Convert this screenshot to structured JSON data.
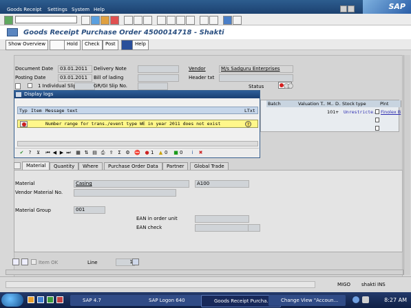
{
  "menu": {
    "items": [
      "Goods Receipt",
      "Settings",
      "System",
      "Help"
    ]
  },
  "brand": "SAP",
  "title": "Goods Receipt Purchase Order 4500014718 - Shakti",
  "app_toolbar": {
    "show_overview": "Show Overview",
    "hold": "Hold",
    "check": "Check",
    "post": "Post",
    "help": "Help"
  },
  "header": {
    "document_date_label": "Document Date",
    "document_date": "03.01.2011",
    "posting_date_label": "Posting Date",
    "posting_date": "03.01.2011",
    "delivery_note_label": "Delivery Note",
    "bill_of_lading_label": "Bill of lading",
    "vendor_label": "Vendor",
    "vendor": "M/s Sadguru Enterprises",
    "header_txt_label": "Header txt",
    "slip_label": "1 Individual Slip",
    "grgi_label": "GR/GI Slip No.",
    "status_label": "Status"
  },
  "dialog": {
    "title": "Display logs",
    "columns": [
      "Typ",
      "Item",
      "Message text",
      "LTxt"
    ],
    "message": "Number range for trans./event type WE in year 2011 does not exist",
    "counts": {
      "error": "1",
      "warning": "0",
      "success": "0"
    }
  },
  "grid": {
    "columns": [
      "Batch",
      "Valuation T..",
      "M..",
      "D..",
      "Stock type",
      "Plnt"
    ],
    "row": {
      "item": "101",
      "sign": "+",
      "stock_type": "Unrestricte..",
      "plant": "Finolex B"
    }
  },
  "tabs": [
    "Material",
    "Quantity",
    "Where",
    "Purchase Order Data",
    "Partner",
    "Global Trade"
  ],
  "detail": {
    "material_label": "Material",
    "material": "Casing",
    "material_code": "A100",
    "vendor_material_label": "Vendor Material No.",
    "material_group_label": "Material Group",
    "material_group": "001",
    "ean_order_unit_label": "EAN in order unit",
    "ean_check_label": "EAN check"
  },
  "footer": {
    "item_ok_label": "Item OK",
    "line_label": "Line",
    "line_value": "1"
  },
  "status": {
    "tcode": "MIGO",
    "server": "shakti",
    "mode": "INS"
  },
  "taskbar": {
    "tasks": [
      "SAP 4.7",
      "SAP Logon 640",
      "Goods Receipt Purcha...",
      "Change View \"Accoun..."
    ],
    "clock": "8:27 AM"
  },
  "colors": {
    "title_blue": "#2a4f80",
    "dialog_row": "#fff78a",
    "error_red": "#cc1f1f"
  }
}
